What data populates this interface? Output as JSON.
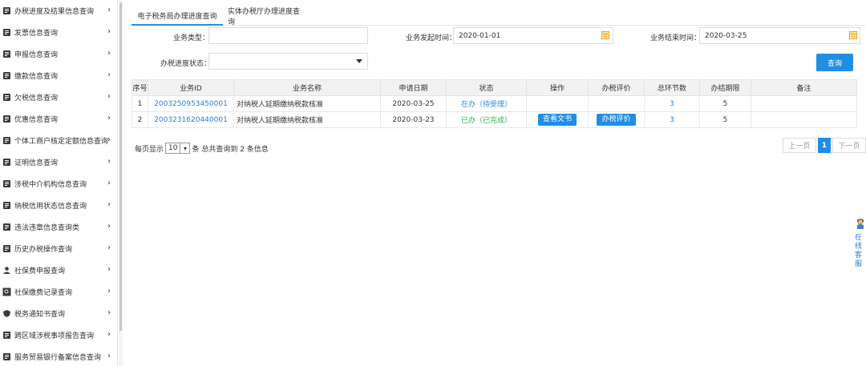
{
  "sidebar": {
    "items": [
      {
        "label": "办税进度及结果信息查询",
        "icon": "progress-doc-icon"
      },
      {
        "label": "发票信息查询",
        "icon": "invoice-icon"
      },
      {
        "label": "申报信息查询",
        "icon": "declare-icon"
      },
      {
        "label": "缴款信息查询",
        "icon": "payment-icon"
      },
      {
        "label": "欠税信息查询",
        "icon": "arrears-icon"
      },
      {
        "label": "优惠信息查询",
        "icon": "discount-icon"
      },
      {
        "label": "个体工商户核定定额信息查询",
        "icon": "business-icon"
      },
      {
        "label": "证明信息查询",
        "icon": "certificate-icon"
      },
      {
        "label": "涉税中介机构信息查询",
        "icon": "agency-icon"
      },
      {
        "label": "纳税信用状态信息查询",
        "icon": "credit-icon"
      },
      {
        "label": "违法违章信息查询类",
        "icon": "violation-icon"
      },
      {
        "label": "历史办税操作查询",
        "icon": "history-icon"
      },
      {
        "label": "社保费申报查询",
        "icon": "social-declare-icon"
      },
      {
        "label": "社保缴费记录查询",
        "icon": "social-record-icon"
      },
      {
        "label": "税务通知书查询",
        "icon": "notice-icon"
      },
      {
        "label": "跨区域涉税事项报告查询",
        "icon": "cross-region-icon"
      },
      {
        "label": "服务贸易银行备案信息查询",
        "icon": "bank-record-icon"
      }
    ],
    "chevron": "›"
  },
  "tabs": {
    "electronic": "电子税务局办理进度查询",
    "physical": "实体办税厅办理进度查询"
  },
  "filters": {
    "biz_type_label": "业务类型：",
    "biz_type_value": "",
    "start_label": "业务发起时间：",
    "start_value": "2020-01-01",
    "end_label": "业务结束时间：",
    "end_value": "2020-03-25",
    "status_label": "办税进度状态：",
    "status_value": "",
    "query_button": "查询"
  },
  "table": {
    "headers": [
      "序号",
      "业务ID",
      "业务名称",
      "申请日期",
      "状态",
      "操作",
      "办税评价",
      "总环节数",
      "办结期限",
      "备注"
    ],
    "rows": [
      {
        "no": "1",
        "id": "2003250953450001",
        "name": "对纳税人延期缴纳税款核准",
        "date": "2020-03-25",
        "status": "在办（待受理）",
        "op": "",
        "eval": "",
        "steps": "3",
        "limit": "5",
        "remark": ""
      },
      {
        "no": "2",
        "id": "2003231620440001",
        "name": "对纳税人延期缴纳税款核准",
        "date": "2020-03-23",
        "status": "已办（已完成）",
        "op": "查看文书",
        "eval": "办税评价",
        "steps": "3",
        "limit": "5",
        "remark": ""
      }
    ]
  },
  "pager": {
    "per_page_prefix": "每页显示",
    "per_page_value": "10",
    "per_page_suffix": "条  总共查询到 2 条信息",
    "prev": "上一页",
    "current": "1",
    "next": "下一页"
  },
  "service": {
    "label": "在线客服"
  },
  "colors": {
    "accent": "#1e8ee6",
    "link": "#2a7fd0",
    "status_pending": "#2a8ee0",
    "status_done": "#27b34b"
  }
}
